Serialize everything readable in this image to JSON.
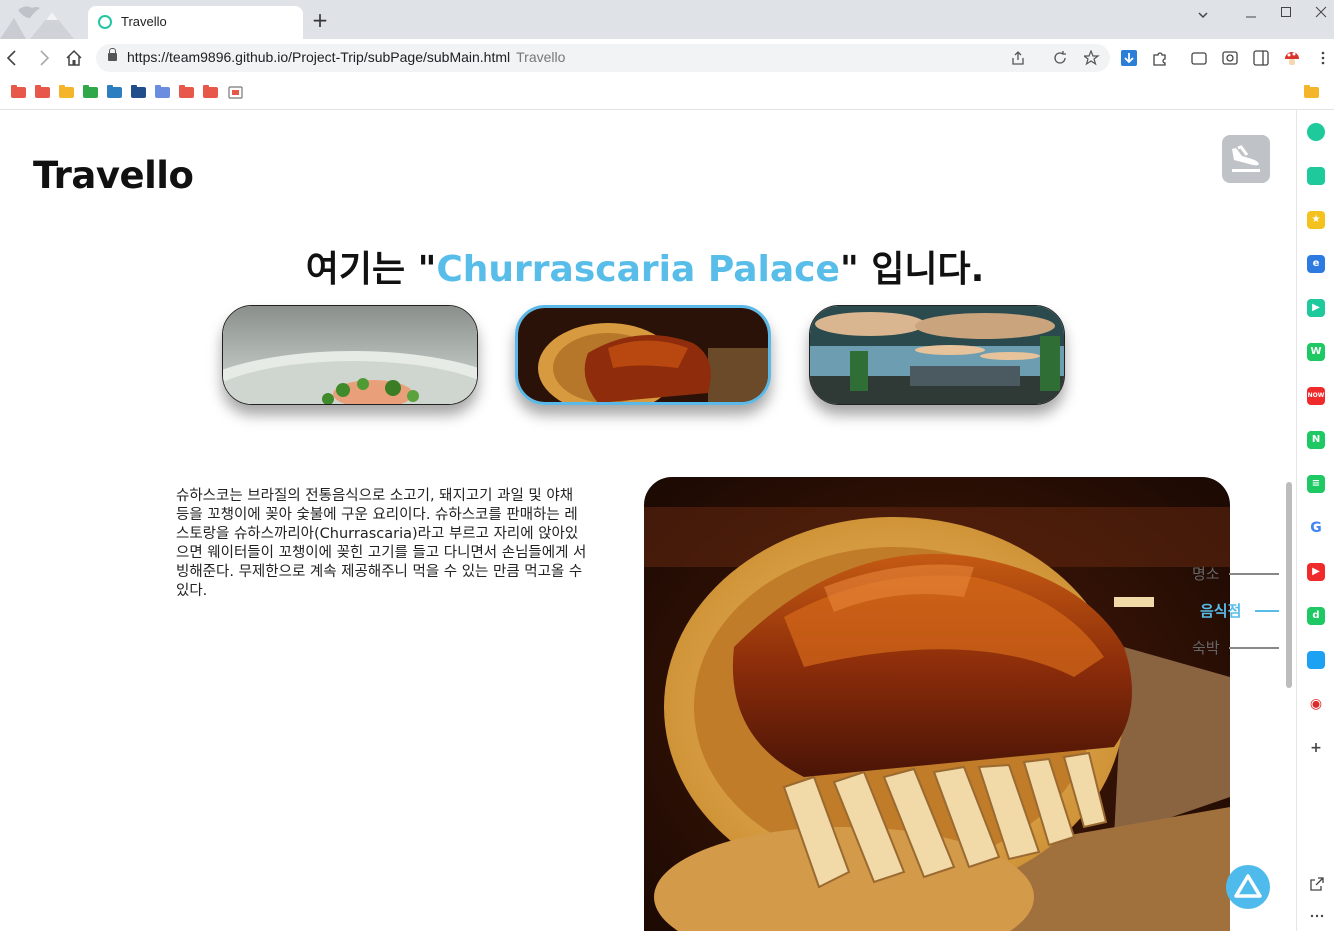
{
  "browser": {
    "tab_title": "Travello",
    "new_tab": "+",
    "url": "https://team9896.github.io/Project-Trip/subPage/subMain.html",
    "url_suffix": "Travello",
    "bookmark_folder_colors": [
      "#e8584a",
      "#e8584a",
      "#f4b52b",
      "#2fa84a",
      "#2b7fc1",
      "#1f4e8a",
      "#6b8de0",
      "#e8584a",
      "#e8584a"
    ],
    "sidebar_icons": [
      {
        "name": "circle-app-icon",
        "color": "#1ec99b",
        "glyph": ""
      },
      {
        "name": "bell-app-icon",
        "color": "#1ec99b",
        "glyph": ""
      },
      {
        "name": "star-app-icon",
        "color": "#f4c21c",
        "glyph": "★"
      },
      {
        "name": "edge-app-icon",
        "color": "#2d7be0",
        "glyph": "e"
      },
      {
        "name": "play-app-icon",
        "color": "#1ec99b",
        "glyph": "▶"
      },
      {
        "name": "webtoon-app-icon",
        "color": "#1ec964",
        "glyph": "W"
      },
      {
        "name": "now-app-icon",
        "color": "#f02a2a",
        "glyph": "NOW"
      },
      {
        "name": "naver-app-icon",
        "color": "#1ec964",
        "glyph": "N"
      },
      {
        "name": "sheets-app-icon",
        "color": "#1ec964",
        "glyph": "≡"
      },
      {
        "name": "google-app-icon",
        "color": "#ffffff",
        "glyph": "G"
      },
      {
        "name": "youtube-app-icon",
        "color": "#f02a2a",
        "glyph": "▶"
      },
      {
        "name": "d-app-icon",
        "color": "#1ec964",
        "glyph": "d"
      },
      {
        "name": "twitter-app-icon",
        "color": "#1da1f2",
        "glyph": ""
      },
      {
        "name": "record-app-icon",
        "color": "#ffffff",
        "glyph": "◉"
      },
      {
        "name": "add-app-icon",
        "color": "#ffffff",
        "glyph": "+"
      }
    ]
  },
  "page": {
    "brand": "Travello",
    "headline_prefix": "여기는 \"",
    "headline_place": "Churrascaria Palace",
    "headline_suffix": "\" 입니다.",
    "description": "슈하스코는 브라질의 전통음식으로 소고기, 돼지고기 과일 및 야채 등을 꼬챙이에 꽂아 숯불에 구운 요리이다. 슈하스코를 판매하는 레스토랑을 슈하스까리아(Churrascaria)라고 부르고 자리에 앉아있으면 웨이터들이 꼬챙이에 꽂힌 고기를 들고 다니면서 손님들에게 서빙해준다. 무제한으로 계속 제공해주니 먹을 수 있는 만큼 먹고올 수있다.",
    "side_nav": [
      {
        "label": "명소",
        "active": false
      },
      {
        "label": "음식점",
        "active": true
      },
      {
        "label": "숙박",
        "active": false
      }
    ],
    "accent_color": "#58bde9"
  }
}
